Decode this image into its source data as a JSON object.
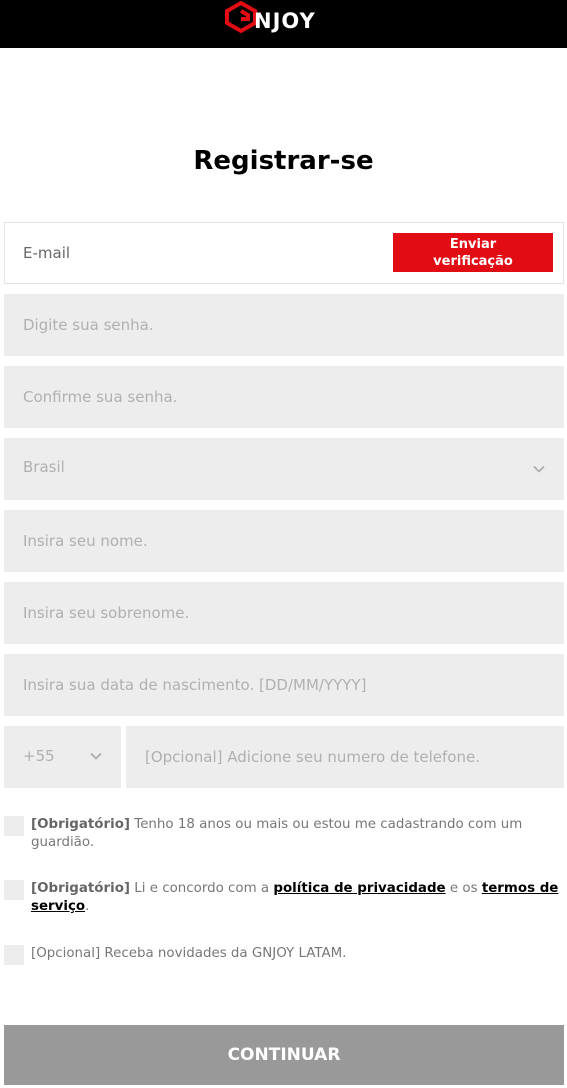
{
  "header": {
    "logo_text": "NJOY",
    "logo_color": "#e20c14",
    "background": "#000000"
  },
  "page_title": "Registrar-se",
  "email": {
    "placeholder": "E-mail",
    "verify_button_label": "Enviar\nverificação"
  },
  "password": {
    "placeholder": "Digite sua senha."
  },
  "confirm_password": {
    "placeholder": "Confirme sua senha."
  },
  "country": {
    "selected": "Brasil"
  },
  "first_name": {
    "placeholder": "Insira seu nome."
  },
  "last_name": {
    "placeholder": "Insira seu sobrenome."
  },
  "birthdate": {
    "placeholder": "Insira sua data de nascimento. [DD/MM/YYYY]"
  },
  "phone": {
    "country_code": "+55",
    "placeholder": "[Opcional] Adicione seu numero de telefone."
  },
  "consents": {
    "age": {
      "tag": "[Obrigatório]",
      "text": " Tenho 18 anos ou mais ou estou me cadastrando com um guardião."
    },
    "terms": {
      "tag": "[Obrigatório]",
      "text_before": " Li e concordo com a ",
      "privacy_link": "política de privacidade",
      "text_middle": " e os ",
      "terms_link": "termos de serviço",
      "text_after": "."
    },
    "newsletter": {
      "text": "[Opcional] Receba novidades da GNJOY LATAM."
    }
  },
  "continue_button_label": "CONTINUAR",
  "colors": {
    "accent": "#e20c14",
    "field_bg": "#ededed",
    "disabled_button": "#999999"
  },
  "icons": {
    "logo": "gnjoy-g-logo-icon",
    "dropdown": "chevron-down-icon"
  }
}
